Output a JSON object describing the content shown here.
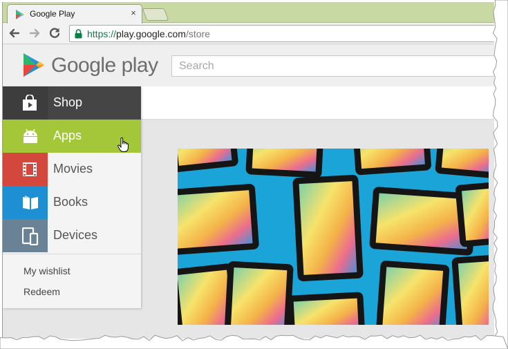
{
  "browser": {
    "tab_title": "Google Play",
    "tab_close": "×",
    "url_scheme": "https://",
    "url_host": "play.google.com",
    "url_path": "/store"
  },
  "store": {
    "logo_text": "Google play",
    "search_placeholder": "Search"
  },
  "sidebar": {
    "items": [
      {
        "label": "Shop",
        "icon": "shopping-bag-icon",
        "icon_bg": "#3d3d3d",
        "row_bg": "#454545",
        "text_color": "#ffffff"
      },
      {
        "label": "Apps",
        "icon": "android-icon",
        "icon_bg": "#a4c639",
        "row_bg": "#a4c639",
        "text_color": "#ffffff"
      },
      {
        "label": "Movies",
        "icon": "film-icon",
        "icon_bg": "#d3473c",
        "row_bg": "#f4f4f4",
        "text_color": "#555555"
      },
      {
        "label": "Books",
        "icon": "book-icon",
        "icon_bg": "#1f8fd3",
        "row_bg": "#f4f4f4",
        "text_color": "#555555"
      },
      {
        "label": "Devices",
        "icon": "devices-icon",
        "icon_bg": "#6a8296",
        "row_bg": "#f4f4f4",
        "text_color": "#555555"
      }
    ],
    "links": [
      "My wishlist",
      "Redeem"
    ]
  },
  "colors": {
    "tab_strip": "#c9d9a3",
    "banner_bg": "#1ba4d8"
  }
}
